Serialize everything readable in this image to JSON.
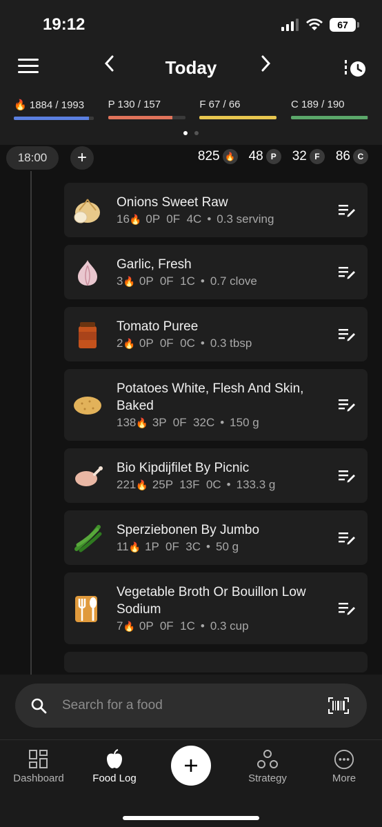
{
  "status": {
    "time": "19:12",
    "battery": "67"
  },
  "header": {
    "title": "Today"
  },
  "macros": [
    {
      "label": "1884 / 1993",
      "prefix": "🔥",
      "fill": 0.94,
      "color": "#5b7fe0"
    },
    {
      "label": "P 130 / 157",
      "prefix": "",
      "fill": 0.83,
      "color": "#e0735a"
    },
    {
      "label": "F 67 / 66",
      "prefix": "",
      "fill": 1.0,
      "color": "#e8c64f"
    },
    {
      "label": "C 189 / 190",
      "prefix": "",
      "fill": 0.99,
      "color": "#5ba86a"
    }
  ],
  "meal": {
    "time": "18:00",
    "add": "+",
    "totals": {
      "cal": "825",
      "p": "48",
      "f": "32",
      "c": "86",
      "p_badge": "P",
      "f_badge": "F",
      "c_badge": "C"
    }
  },
  "foods": [
    {
      "name": "Onions Sweet Raw",
      "cal": "16",
      "macros": "0P  0F  4C",
      "serving": "0.3 serving",
      "icon": "onion-icon"
    },
    {
      "name": "Garlic, Fresh",
      "cal": "3",
      "macros": "0P  0F  1C",
      "serving": "0.7 clove",
      "icon": "garlic-icon"
    },
    {
      "name": "Tomato Puree",
      "cal": "2",
      "macros": "0P  0F  0C",
      "serving": "0.3 tbsp",
      "icon": "tomato-puree-icon"
    },
    {
      "name": "Potatoes White, Flesh And Skin, Baked",
      "cal": "138",
      "macros": "3P  0F  32C",
      "serving": "150 g",
      "icon": "potato-icon"
    },
    {
      "name": "Bio Kipdijfilet By Picnic",
      "cal": "221",
      "macros": "25P  13F  0C",
      "serving": "133.3 g",
      "icon": "chicken-icon"
    },
    {
      "name": "Sperziebonen By Jumbo",
      "cal": "11",
      "macros": "1P  0F  3C",
      "serving": "50 g",
      "icon": "green-beans-icon"
    },
    {
      "name": "Vegetable Broth Or Bouillon Low Sodium",
      "cal": "7",
      "macros": "0P  0F  1C",
      "serving": "0.3 cup",
      "icon": "utensils-icon"
    }
  ],
  "search": {
    "placeholder": "Search for a food"
  },
  "tabs": {
    "dashboard": "Dashboard",
    "food_log": "Food Log",
    "strategy": "Strategy",
    "more": "More"
  }
}
